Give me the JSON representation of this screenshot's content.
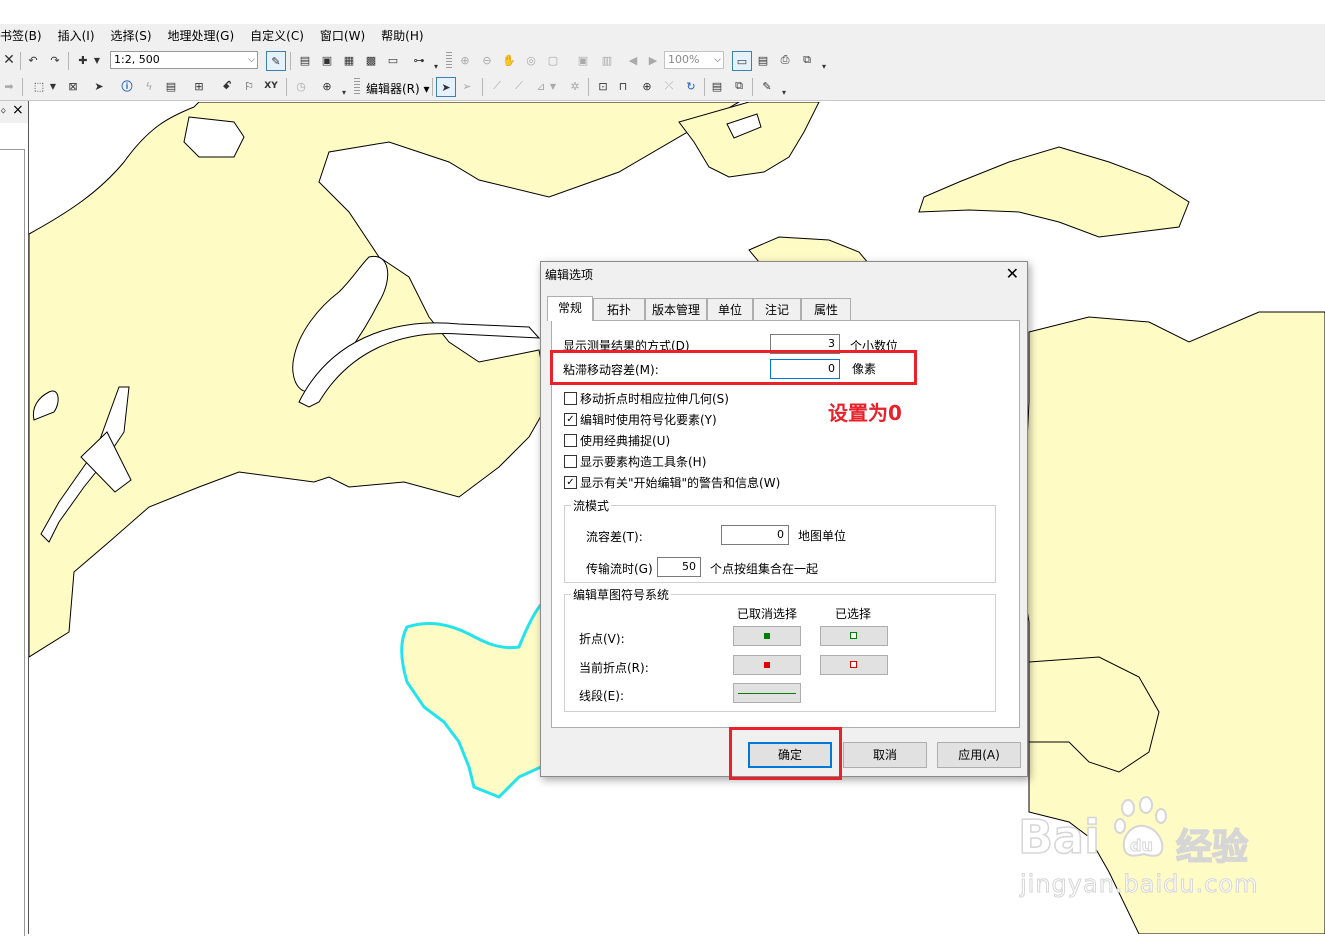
{
  "menu": [
    "书签(B)",
    "插入(I)",
    "选择(S)",
    "地理处理(G)",
    "自定义(C)",
    "窗口(W)",
    "帮助(H)"
  ],
  "toolbar": {
    "scale": "1:2, 500",
    "zoom": "100%",
    "editor_label": "编辑器(R)"
  },
  "left_panel": {
    "pin": "ᛜ",
    "close": "×"
  },
  "dialog": {
    "title": "编辑选项",
    "close": "✕",
    "tabs": [
      "常规",
      "拓扑",
      "版本管理",
      "单位",
      "注记",
      "属性"
    ],
    "measure_label": "显示测量结果的方式(D)",
    "measure_value": "3",
    "measure_unit": "个小数位",
    "sticky_label": "粘滞移动容差(M):",
    "sticky_value": "0",
    "sticky_unit": "像素",
    "checkboxes": [
      {
        "label": "移动折点时相应拉伸几何(S)",
        "checked": false
      },
      {
        "label": "编辑时使用符号化要素(Y)",
        "checked": true
      },
      {
        "label": "使用经典捕捉(U)",
        "checked": false
      },
      {
        "label": "显示要素构造工具条(H)",
        "checked": false
      },
      {
        "label": "显示有关\"开始编辑\"的警告和信息(W)",
        "checked": true
      }
    ],
    "stream": {
      "title": "流模式",
      "tolerance_label": "流容差(T):",
      "tolerance_value": "0",
      "tolerance_unit": "地图单位",
      "group_label": "传输流时(G)",
      "group_value": "50",
      "group_unit": "个点按组集合在一起"
    },
    "sketch": {
      "title": "编辑草图符号系统",
      "col_unselected": "已取消选择",
      "col_selected": "已选择",
      "vertex_label": "折点(V):",
      "current_vertex_label": "当前折点(R):",
      "segment_label": "线段(E):"
    },
    "buttons": {
      "ok": "确定",
      "cancel": "取消",
      "apply": "应用(A)"
    }
  },
  "annotation": "设置为0",
  "watermark": {
    "brand": "Bai",
    "brand_cn": "经验",
    "url": "jingyan.baidu.com"
  },
  "colors": {
    "land": "#fffbc5",
    "highlight_outline": "#23e4ec",
    "annotation_red": "#e8212b",
    "vertex_green": "#008000",
    "vertex_red": "#e00000"
  }
}
